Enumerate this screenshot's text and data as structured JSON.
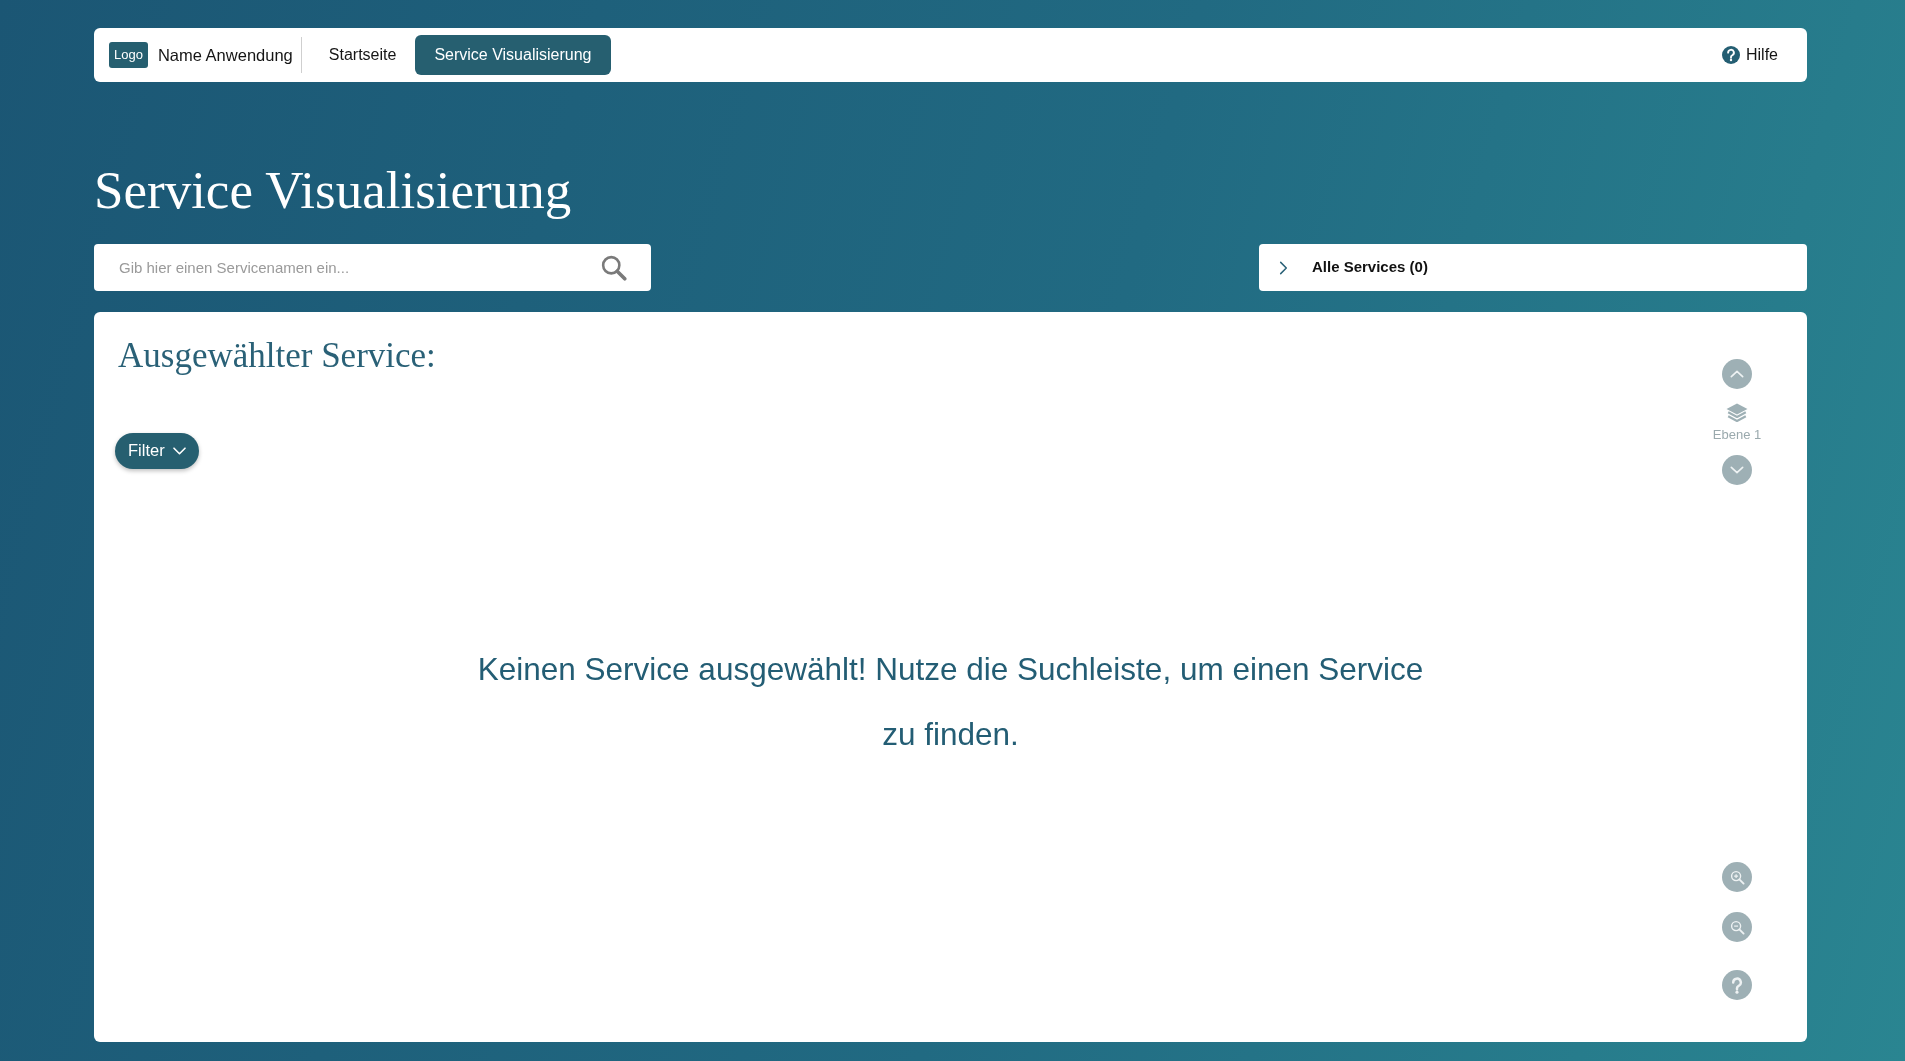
{
  "navbar": {
    "logo": "Logo",
    "app_name": "Name Anwendung",
    "items": [
      {
        "label": "Startseite",
        "selected": false
      },
      {
        "label": "Service Visualisierung",
        "selected": true
      }
    ],
    "help": "Hilfe"
  },
  "page_title": "Service Visualisierung",
  "search": {
    "placeholder": "Gib hier einen Servicenamen ein..."
  },
  "services_panel": {
    "label": "Alle Services (0)",
    "expanded": false
  },
  "card": {
    "title": "Ausgewählter Service:",
    "filter_button": "Filter",
    "level_control": {
      "label": "Ebene 1"
    },
    "message": "Keinen Service ausgewählt! Nutze die Suchleiste, um einen Service zu finden."
  }
}
